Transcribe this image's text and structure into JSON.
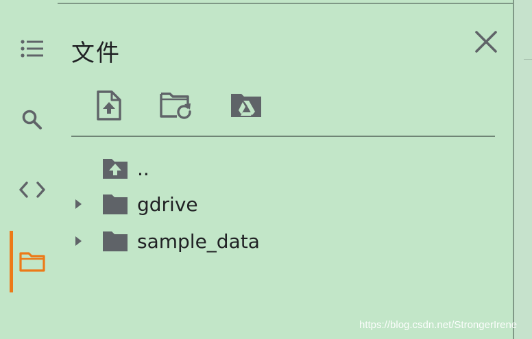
{
  "panel": {
    "title": "文件"
  },
  "sidebar": {
    "items": [
      {
        "icon": "list-icon",
        "active": false
      },
      {
        "icon": "search-icon",
        "active": false
      },
      {
        "icon": "code-icon",
        "active": false
      },
      {
        "icon": "folder-icon",
        "active": true
      }
    ],
    "active_color": "#ec7a18"
  },
  "toolbar": {
    "buttons": [
      {
        "icon": "upload-file-icon"
      },
      {
        "icon": "refresh-folder-icon"
      },
      {
        "icon": "mount-drive-icon"
      }
    ]
  },
  "files": {
    "items": [
      {
        "name": "..",
        "icon": "folder-up-icon",
        "expandable": false
      },
      {
        "name": "gdrive",
        "icon": "folder-icon",
        "expandable": true
      },
      {
        "name": "sample_data",
        "icon": "folder-icon",
        "expandable": true
      }
    ]
  },
  "watermark": "https://blog.csdn.net/StrongerIrene",
  "colors": {
    "background": "#c2e6c8",
    "icon": "#5f6368",
    "accent": "#ec7a18"
  }
}
